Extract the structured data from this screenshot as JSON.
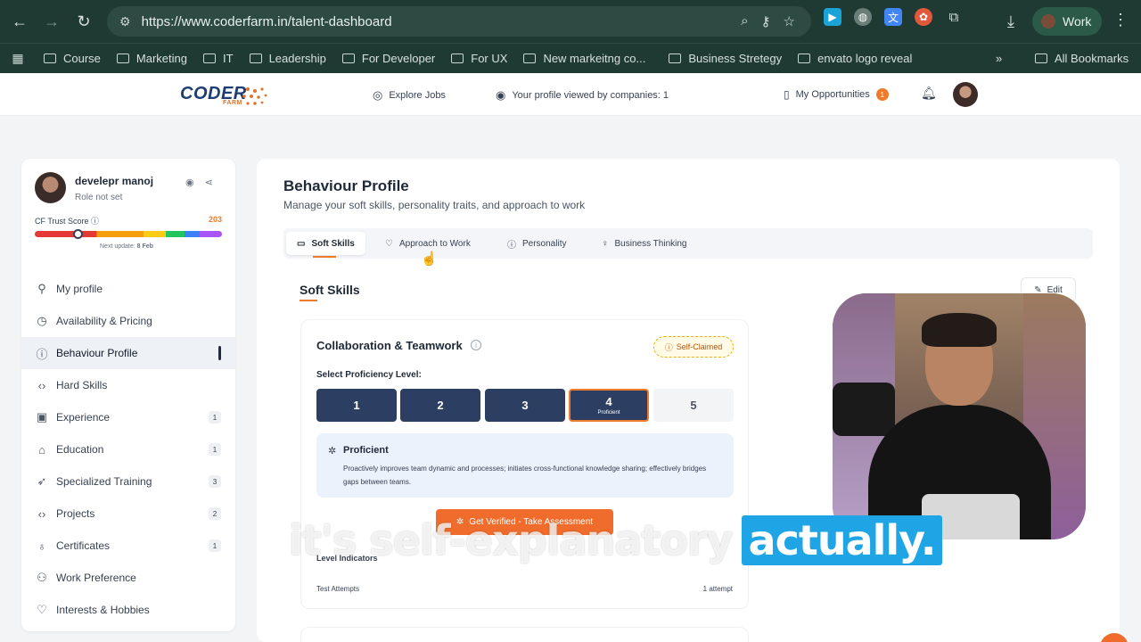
{
  "browser": {
    "url": "https://www.coderfarm.in/talent-dashboard",
    "profile_label": "Work",
    "bookmarks": [
      "Course",
      "Marketing",
      "IT",
      "Leadership",
      "For Developer",
      "For UX",
      "New markeitng co...",
      "Business Stretegy",
      "envato logo reveal"
    ],
    "all_bookmarks": "All Bookmarks",
    "overflow": "»"
  },
  "header": {
    "logo_text": "CODER",
    "logo_sub": "FARM",
    "explore_jobs": "Explore Jobs",
    "profile_views": "Your profile viewed by companies: 1",
    "opportunities": "My Opportunities",
    "opportunities_count": "1"
  },
  "sidebar": {
    "name": "develepr manoj",
    "role": "Role not set",
    "trust_label": "CF Trust Score",
    "trust_value": "203",
    "next_update_prefix": "Next update:",
    "next_update_date": "8 Feb",
    "items": [
      {
        "label": "My profile",
        "icon": "user-icon"
      },
      {
        "label": "Availability & Pricing",
        "icon": "clock-icon"
      },
      {
        "label": "Behaviour Profile",
        "icon": "info-circle-icon",
        "active": true
      },
      {
        "label": "Hard Skills",
        "icon": "code-icon"
      },
      {
        "label": "Experience",
        "icon": "briefcase-icon",
        "count": "1"
      },
      {
        "label": "Education",
        "icon": "graduation-cap-icon",
        "count": "1"
      },
      {
        "label": "Specialized Training",
        "icon": "rocket-icon",
        "count": "3"
      },
      {
        "label": "Projects",
        "icon": "code-icon",
        "count": "2"
      },
      {
        "label": "Certificates",
        "icon": "award-icon",
        "count": "1"
      },
      {
        "label": "Work Preference",
        "icon": "users-icon"
      },
      {
        "label": "Interests & Hobbies",
        "icon": "heart-icon"
      }
    ]
  },
  "main": {
    "title": "Behaviour Profile",
    "subtitle": "Manage your soft skills, personality traits, and approach to work",
    "tabs": [
      "Soft Skills",
      "Approach to Work",
      "Personality",
      "Business Thinking"
    ],
    "section_title": "Soft Skills",
    "edit_label": "Edit",
    "card": {
      "title": "Collaboration & Teamwork",
      "status": "Self-Claimed",
      "select_label": "Select Proficiency Level:",
      "levels": [
        "1",
        "2",
        "3",
        "4",
        "5"
      ],
      "selected_caption": "Proficient",
      "prof_title": "Proficient",
      "prof_desc": "Proactively improves team dynamic and processes; initiates cross-functional knowledge sharing; effectively bridges gaps between teams.",
      "verify_label": "Get Verified - Take Assessment",
      "level_indicators": "Level Indicators",
      "test_attempts": "Test Attempts",
      "attempt_count": "1 attempt"
    }
  },
  "caption": {
    "plain": "it's self-explanatory",
    "highlight": "actually."
  },
  "colors": {
    "accent": "#f07c2b",
    "navy": "#2d3e63",
    "caption_highlight": "#1fa5e6"
  }
}
